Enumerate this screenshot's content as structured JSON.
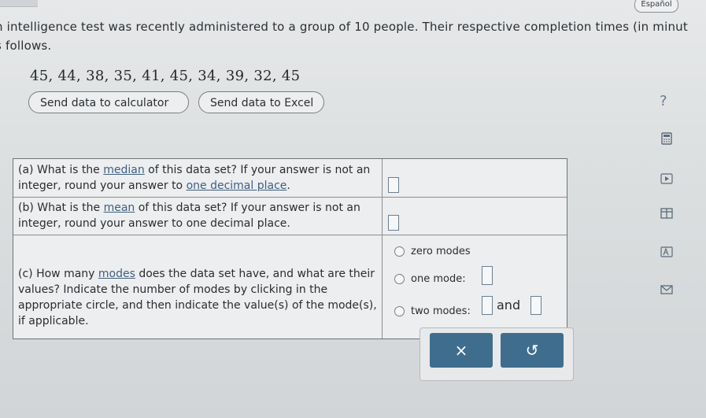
{
  "header": {
    "language_label": "Español"
  },
  "question": {
    "line1": "n intelligence test was recently administered to a group of 10 people. Their respective completion times (in minut",
    "line2": "s follows.",
    "data_values": "45, 44, 38, 35, 41, 45, 34, 39, 32, 45"
  },
  "toolbar": {
    "calculator_label": "Send data to calculator",
    "excel_label": "Send data to Excel",
    "help_label": "?"
  },
  "sidebar_icons": [
    "calculator-icon",
    "play-icon",
    "table-icon",
    "font-icon",
    "mail-icon"
  ],
  "parts": {
    "a": {
      "pre": "(a) What is the ",
      "link": "median",
      "mid": " of this data set? If your answer is not an integer, round your answer to ",
      "link2": "one decimal place",
      "post": "."
    },
    "b": {
      "pre": "(b) What is the ",
      "link": "mean",
      "post": " of this data set? If your answer is not an integer, round your answer to one decimal place."
    },
    "c": {
      "pre": "(c) How many ",
      "link": "modes",
      "post": " does the data set have, and what are their values? Indicate the number of modes by clicking in the appropriate circle, and then indicate the value(s) of the mode(s), if applicable."
    }
  },
  "mode_options": {
    "zero": "zero modes",
    "one": "one mode:",
    "two": "two modes:",
    "and_label": "and"
  },
  "actions": {
    "clear_symbol": "×",
    "undo_symbol": "↺"
  }
}
